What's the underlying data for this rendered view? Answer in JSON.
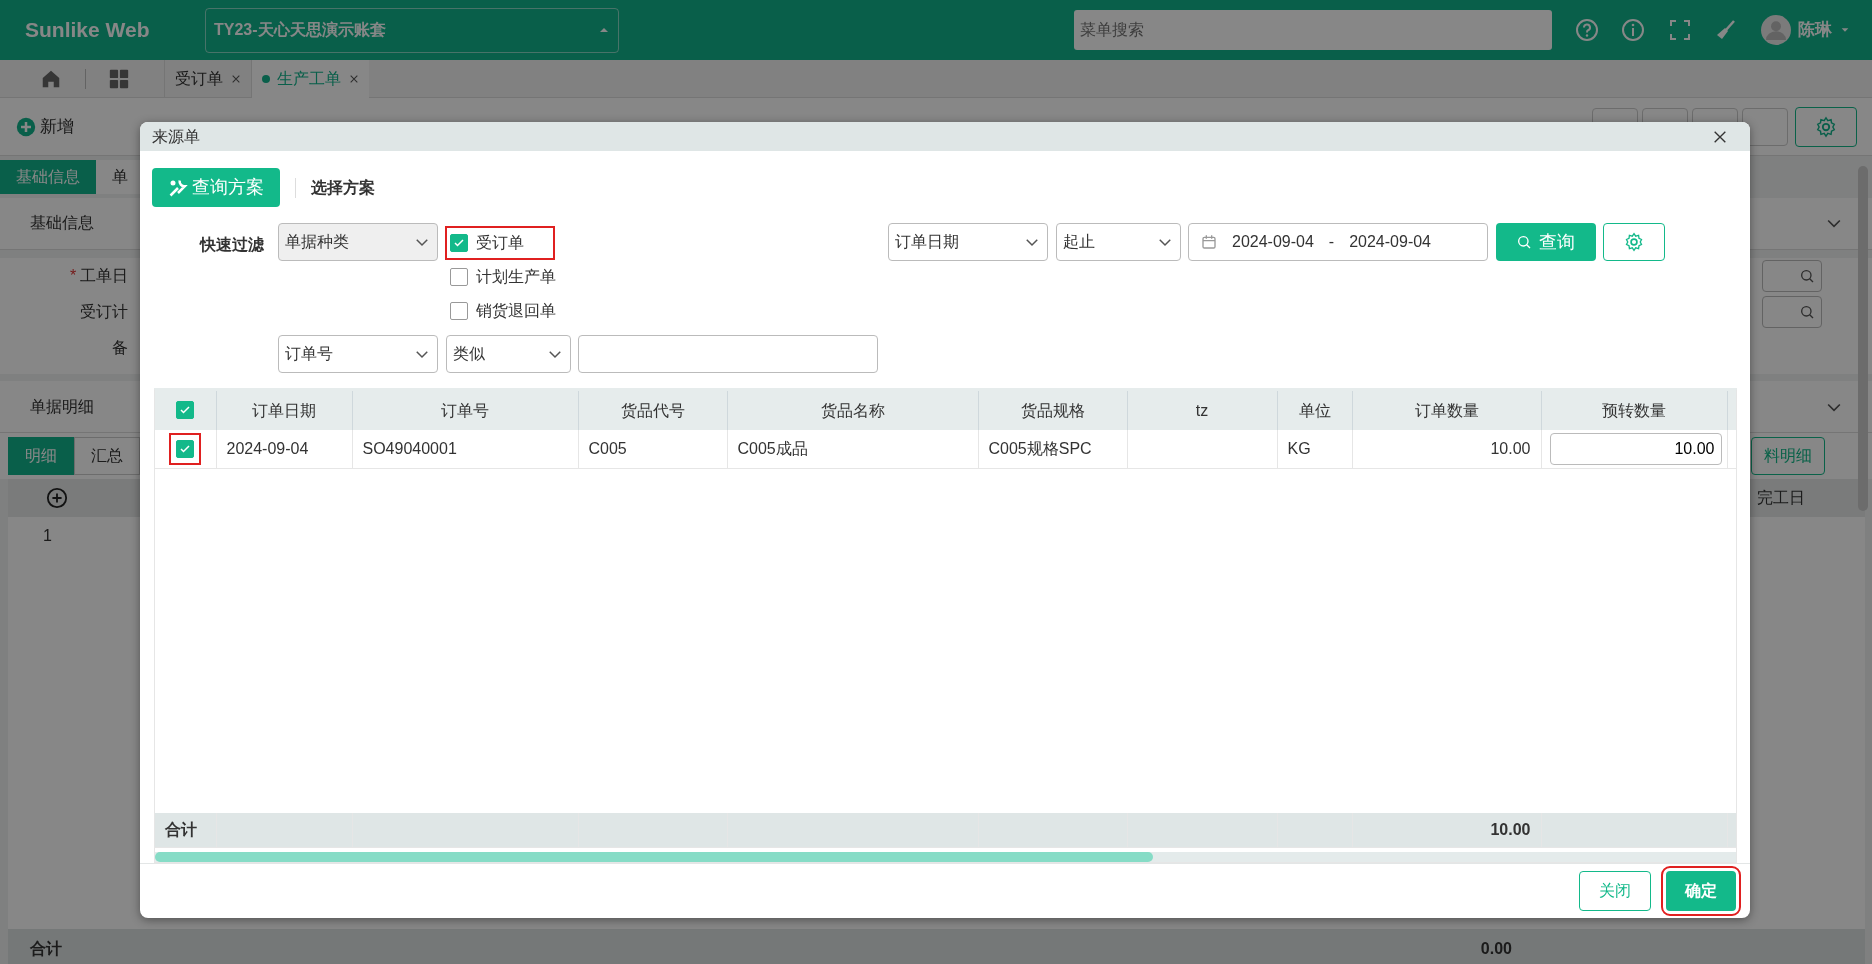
{
  "app": {
    "brand": "Sunlike Web",
    "account": "TY23-天心天思演示账套",
    "search": {
      "placeholder": "菜单搜索"
    },
    "user": "陈琳"
  },
  "page_tabs": [
    {
      "label": "受订单",
      "selected": false
    },
    {
      "label": "生产工单",
      "selected": true
    }
  ],
  "toolbar": {
    "new_label": "新增"
  },
  "form_tabs": [
    {
      "label": "基础信息",
      "selected": true
    },
    {
      "label": "单",
      "selected": false
    }
  ],
  "basic_info": {
    "title": "基础信息",
    "fields": [
      {
        "marker": "*",
        "label": "工单日"
      },
      {
        "label": "受订计"
      },
      {
        "label": "备"
      }
    ]
  },
  "detail": {
    "title": "单据明细",
    "tabs": [
      {
        "label": "明细",
        "selected": true
      },
      {
        "label": "汇总",
        "selected": false
      }
    ],
    "row_numbers": [
      "1"
    ],
    "column_tail": "完工日",
    "button": "料明细",
    "total_label": "合计",
    "total_value": "0.00"
  },
  "dialog": {
    "title": "来源单",
    "query_scheme": "查询方案",
    "select_scheme": "选择方案",
    "filter_label": "快速过滤",
    "doc_type_select": "单据种类",
    "doc_types": [
      {
        "label": "受订单",
        "checked": true,
        "highlighted": true
      },
      {
        "label": "计划生产单",
        "checked": false,
        "highlighted": false
      },
      {
        "label": "销货退回单",
        "checked": false,
        "highlighted": false
      }
    ],
    "date_field": "订单日期",
    "date_mode": "起止",
    "date_from": "2024-09-04",
    "date_sep": "-",
    "date_to": "2024-09-04",
    "search_button": "查询",
    "cond_field": "订单号",
    "cond_op": "类似",
    "table": {
      "all_checked": true,
      "columns": [
        {
          "label": "订单日期",
          "kind": "text"
        },
        {
          "label": "订单号",
          "kind": "text"
        },
        {
          "label": "货品代号",
          "kind": "text"
        },
        {
          "label": "货品名称",
          "kind": "text"
        },
        {
          "label": "货品规格",
          "kind": "text"
        },
        {
          "label": "tz",
          "kind": "text"
        },
        {
          "label": "单位",
          "kind": "text"
        },
        {
          "label": "订单数量",
          "kind": "number",
          "total": "10.00"
        },
        {
          "label": "预转数量",
          "kind": "input"
        }
      ],
      "rows": [
        {
          "selected": true,
          "highlighted": true,
          "cells": [
            "2024-09-04",
            "SO49040001",
            "C005",
            "C005成品",
            "C005规格SPC",
            null,
            "KG",
            "10.00",
            "10.00"
          ]
        }
      ],
      "total_label": "合计"
    },
    "footer_buttons": [
      {
        "label": "关闭",
        "kind": "outline",
        "highlighted": false
      },
      {
        "label": "确定",
        "kind": "primary",
        "highlighted": true
      }
    ]
  }
}
